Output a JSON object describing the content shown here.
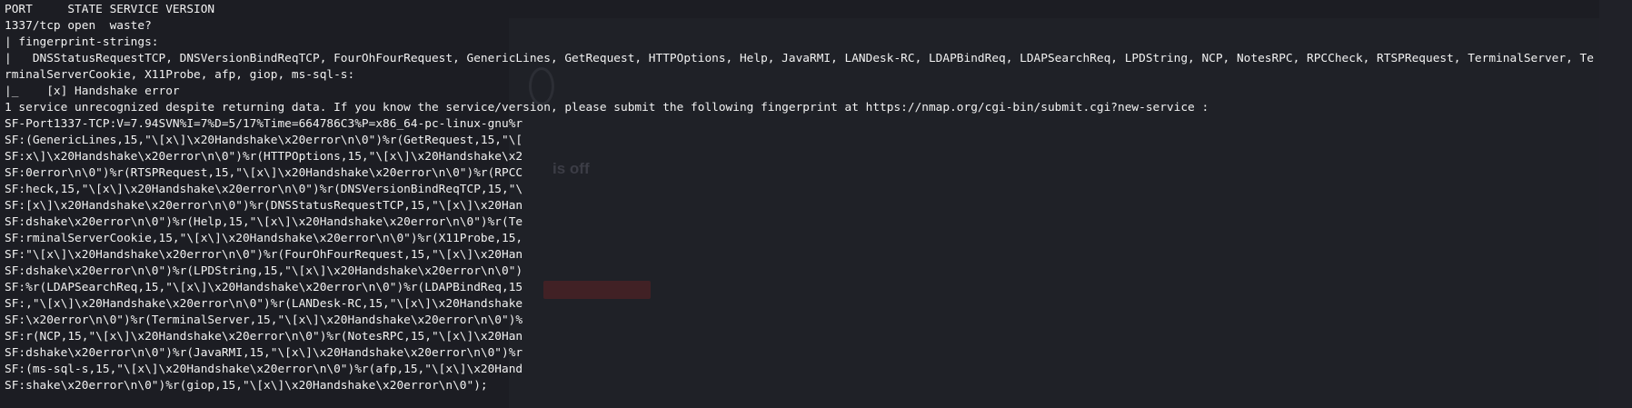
{
  "terminal": {
    "lines": [
      "PORT     STATE SERVICE VERSION",
      "1337/tcp open  waste?",
      "| fingerprint-strings:",
      "|   DNSStatusRequestTCP, DNSVersionBindReqTCP, FourOhFourRequest, GenericLines, GetRequest, HTTPOptions, Help, JavaRMI, LANDesk-RC, LDAPBindReq, LDAPSearchReq, LPDString, NCP, NotesRPC, RPCCheck, RTSPRequest, TerminalServer, Te",
      "rminalServerCookie, X11Probe, afp, giop, ms-sql-s:",
      "|_    [x] Handshake error",
      "1 service unrecognized despite returning data. If you know the service/version, please submit the following fingerprint at https://nmap.org/cgi-bin/submit.cgi?new-service :",
      "SF-Port1337-TCP:V=7.94SVN%I=7%D=5/17%Time=664786C3%P=x86_64-pc-linux-gnu%r",
      "SF:(GenericLines,15,\"\\[x\\]\\x20Handshake\\x20error\\n\\0\")%r(GetRequest,15,\"\\[",
      "SF:x\\]\\x20Handshake\\x20error\\n\\0\")%r(HTTPOptions,15,\"\\[x\\]\\x20Handshake\\x2",
      "SF:0error\\n\\0\")%r(RTSPRequest,15,\"\\[x\\]\\x20Handshake\\x20error\\n\\0\")%r(RPCC",
      "SF:heck,15,\"\\[x\\]\\x20Handshake\\x20error\\n\\0\")%r(DNSVersionBindReqTCP,15,\"\\",
      "SF:[x\\]\\x20Handshake\\x20error\\n\\0\")%r(DNSStatusRequestTCP,15,\"\\[x\\]\\x20Han",
      "SF:dshake\\x20error\\n\\0\")%r(Help,15,\"\\[x\\]\\x20Handshake\\x20error\\n\\0\")%r(Te",
      "SF:rminalServerCookie,15,\"\\[x\\]\\x20Handshake\\x20error\\n\\0\")%r(X11Probe,15,",
      "SF:\"\\[x\\]\\x20Handshake\\x20error\\n\\0\")%r(FourOhFourRequest,15,\"\\[x\\]\\x20Han",
      "SF:dshake\\x20error\\n\\0\")%r(LPDString,15,\"\\[x\\]\\x20Handshake\\x20error\\n\\0\")",
      "SF:%r(LDAPSearchReq,15,\"\\[x\\]\\x20Handshake\\x20error\\n\\0\")%r(LDAPBindReq,15",
      "SF:,\"\\[x\\]\\x20Handshake\\x20error\\n\\0\")%r(LANDesk-RC,15,\"\\[x\\]\\x20Handshake",
      "SF:\\x20error\\n\\0\")%r(TerminalServer,15,\"\\[x\\]\\x20Handshake\\x20error\\n\\0\")%",
      "SF:r(NCP,15,\"\\[x\\]\\x20Handshake\\x20error\\n\\0\")%r(NotesRPC,15,\"\\[x\\]\\x20Han",
      "SF:dshake\\x20error\\n\\0\")%r(JavaRMI,15,\"\\[x\\]\\x20Handshake\\x20error\\n\\0\")%r",
      "SF:(ms-sql-s,15,\"\\[x\\]\\x20Handshake\\x20error\\n\\0\")%r(afp,15,\"\\[x\\]\\x20Hand",
      "SF:shake\\x20error\\n\\0\")%r(giop,15,\"\\[x\\]\\x20Handshake\\x20error\\n\\0\");"
    ]
  },
  "background": {
    "heading": "is off"
  },
  "colors": {
    "terminal_bg": "#1c1d23",
    "terminal_fg": "#f2f2f2"
  }
}
